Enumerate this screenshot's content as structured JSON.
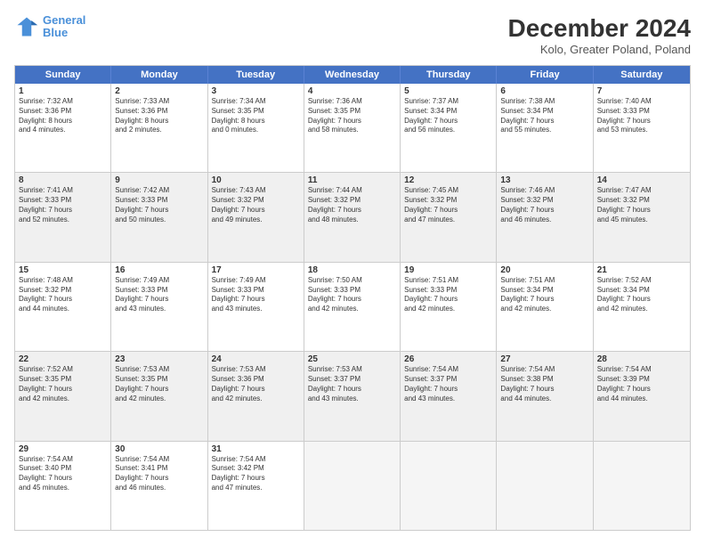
{
  "header": {
    "logo_line1": "General",
    "logo_line2": "Blue",
    "month": "December 2024",
    "location": "Kolo, Greater Poland, Poland"
  },
  "days_of_week": [
    "Sunday",
    "Monday",
    "Tuesday",
    "Wednesday",
    "Thursday",
    "Friday",
    "Saturday"
  ],
  "weeks": [
    [
      {
        "day": "1",
        "info": "Sunrise: 7:32 AM\nSunset: 3:36 PM\nDaylight: 8 hours\nand 4 minutes.",
        "shaded": false
      },
      {
        "day": "2",
        "info": "Sunrise: 7:33 AM\nSunset: 3:36 PM\nDaylight: 8 hours\nand 2 minutes.",
        "shaded": false
      },
      {
        "day": "3",
        "info": "Sunrise: 7:34 AM\nSunset: 3:35 PM\nDaylight: 8 hours\nand 0 minutes.",
        "shaded": false
      },
      {
        "day": "4",
        "info": "Sunrise: 7:36 AM\nSunset: 3:35 PM\nDaylight: 7 hours\nand 58 minutes.",
        "shaded": false
      },
      {
        "day": "5",
        "info": "Sunrise: 7:37 AM\nSunset: 3:34 PM\nDaylight: 7 hours\nand 56 minutes.",
        "shaded": false
      },
      {
        "day": "6",
        "info": "Sunrise: 7:38 AM\nSunset: 3:34 PM\nDaylight: 7 hours\nand 55 minutes.",
        "shaded": false
      },
      {
        "day": "7",
        "info": "Sunrise: 7:40 AM\nSunset: 3:33 PM\nDaylight: 7 hours\nand 53 minutes.",
        "shaded": false
      }
    ],
    [
      {
        "day": "8",
        "info": "Sunrise: 7:41 AM\nSunset: 3:33 PM\nDaylight: 7 hours\nand 52 minutes.",
        "shaded": true
      },
      {
        "day": "9",
        "info": "Sunrise: 7:42 AM\nSunset: 3:33 PM\nDaylight: 7 hours\nand 50 minutes.",
        "shaded": true
      },
      {
        "day": "10",
        "info": "Sunrise: 7:43 AM\nSunset: 3:32 PM\nDaylight: 7 hours\nand 49 minutes.",
        "shaded": true
      },
      {
        "day": "11",
        "info": "Sunrise: 7:44 AM\nSunset: 3:32 PM\nDaylight: 7 hours\nand 48 minutes.",
        "shaded": true
      },
      {
        "day": "12",
        "info": "Sunrise: 7:45 AM\nSunset: 3:32 PM\nDaylight: 7 hours\nand 47 minutes.",
        "shaded": true
      },
      {
        "day": "13",
        "info": "Sunrise: 7:46 AM\nSunset: 3:32 PM\nDaylight: 7 hours\nand 46 minutes.",
        "shaded": true
      },
      {
        "day": "14",
        "info": "Sunrise: 7:47 AM\nSunset: 3:32 PM\nDaylight: 7 hours\nand 45 minutes.",
        "shaded": true
      }
    ],
    [
      {
        "day": "15",
        "info": "Sunrise: 7:48 AM\nSunset: 3:32 PM\nDaylight: 7 hours\nand 44 minutes.",
        "shaded": false
      },
      {
        "day": "16",
        "info": "Sunrise: 7:49 AM\nSunset: 3:33 PM\nDaylight: 7 hours\nand 43 minutes.",
        "shaded": false
      },
      {
        "day": "17",
        "info": "Sunrise: 7:49 AM\nSunset: 3:33 PM\nDaylight: 7 hours\nand 43 minutes.",
        "shaded": false
      },
      {
        "day": "18",
        "info": "Sunrise: 7:50 AM\nSunset: 3:33 PM\nDaylight: 7 hours\nand 42 minutes.",
        "shaded": false
      },
      {
        "day": "19",
        "info": "Sunrise: 7:51 AM\nSunset: 3:33 PM\nDaylight: 7 hours\nand 42 minutes.",
        "shaded": false
      },
      {
        "day": "20",
        "info": "Sunrise: 7:51 AM\nSunset: 3:34 PM\nDaylight: 7 hours\nand 42 minutes.",
        "shaded": false
      },
      {
        "day": "21",
        "info": "Sunrise: 7:52 AM\nSunset: 3:34 PM\nDaylight: 7 hours\nand 42 minutes.",
        "shaded": false
      }
    ],
    [
      {
        "day": "22",
        "info": "Sunrise: 7:52 AM\nSunset: 3:35 PM\nDaylight: 7 hours\nand 42 minutes.",
        "shaded": true
      },
      {
        "day": "23",
        "info": "Sunrise: 7:53 AM\nSunset: 3:35 PM\nDaylight: 7 hours\nand 42 minutes.",
        "shaded": true
      },
      {
        "day": "24",
        "info": "Sunrise: 7:53 AM\nSunset: 3:36 PM\nDaylight: 7 hours\nand 42 minutes.",
        "shaded": true
      },
      {
        "day": "25",
        "info": "Sunrise: 7:53 AM\nSunset: 3:37 PM\nDaylight: 7 hours\nand 43 minutes.",
        "shaded": true
      },
      {
        "day": "26",
        "info": "Sunrise: 7:54 AM\nSunset: 3:37 PM\nDaylight: 7 hours\nand 43 minutes.",
        "shaded": true
      },
      {
        "day": "27",
        "info": "Sunrise: 7:54 AM\nSunset: 3:38 PM\nDaylight: 7 hours\nand 44 minutes.",
        "shaded": true
      },
      {
        "day": "28",
        "info": "Sunrise: 7:54 AM\nSunset: 3:39 PM\nDaylight: 7 hours\nand 44 minutes.",
        "shaded": true
      }
    ],
    [
      {
        "day": "29",
        "info": "Sunrise: 7:54 AM\nSunset: 3:40 PM\nDaylight: 7 hours\nand 45 minutes.",
        "shaded": false
      },
      {
        "day": "30",
        "info": "Sunrise: 7:54 AM\nSunset: 3:41 PM\nDaylight: 7 hours\nand 46 minutes.",
        "shaded": false
      },
      {
        "day": "31",
        "info": "Sunrise: 7:54 AM\nSunset: 3:42 PM\nDaylight: 7 hours\nand 47 minutes.",
        "shaded": false
      },
      {
        "day": "",
        "info": "",
        "shaded": false,
        "empty": true
      },
      {
        "day": "",
        "info": "",
        "shaded": false,
        "empty": true
      },
      {
        "day": "",
        "info": "",
        "shaded": false,
        "empty": true
      },
      {
        "day": "",
        "info": "",
        "shaded": false,
        "empty": true
      }
    ]
  ]
}
